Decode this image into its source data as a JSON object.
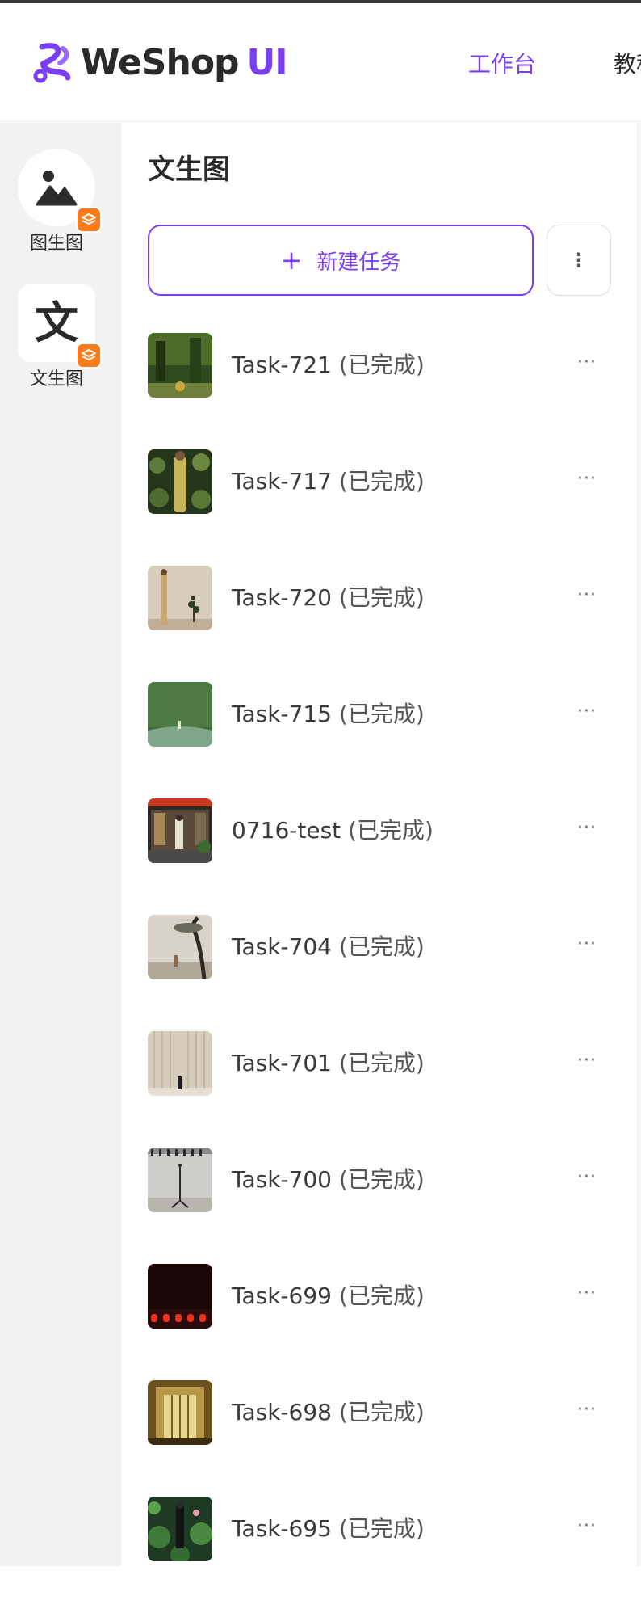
{
  "header": {
    "logo_text": "WeShop",
    "logo_accent": "UI",
    "nav": {
      "workbench": "工作台",
      "tutorial": "教程"
    },
    "brand_color": "#7b3ff2"
  },
  "sidebar": {
    "items": [
      {
        "label": "图生图",
        "icon": "mountain-image-icon",
        "badge_icon": "layers-icon"
      },
      {
        "label": "文生图",
        "icon_text": "文",
        "badge_icon": "layers-icon"
      }
    ],
    "badge_color": "#ff7a1a"
  },
  "panel": {
    "title": "文生图",
    "new_task_plus": "+",
    "new_task_label": "新建任务",
    "more_label": "⋮"
  },
  "tasks": [
    {
      "name": "Task-721",
      "status": "(已完成)",
      "thumb": "forest"
    },
    {
      "name": "Task-717",
      "status": "(已完成)",
      "thumb": "lilypad-dress"
    },
    {
      "name": "Task-720",
      "status": "(已完成)",
      "thumb": "beige-plant"
    },
    {
      "name": "Task-715",
      "status": "(已完成)",
      "thumb": "green-wall"
    },
    {
      "name": "0716-test",
      "status": "(已完成)",
      "thumb": "store-front"
    },
    {
      "name": "Task-704",
      "status": "(已完成)",
      "thumb": "tree-fog"
    },
    {
      "name": "Task-701",
      "status": "(已完成)",
      "thumb": "beige-curtain"
    },
    {
      "name": "Task-700",
      "status": "(已完成)",
      "thumb": "studio-mic"
    },
    {
      "name": "Task-699",
      "status": "(已完成)",
      "thumb": "dark-lights"
    },
    {
      "name": "Task-698",
      "status": "(已完成)",
      "thumb": "gold-door"
    },
    {
      "name": "Task-695",
      "status": "(已完成)",
      "thumb": "lotus-figure"
    }
  ],
  "row_more_label": "···"
}
